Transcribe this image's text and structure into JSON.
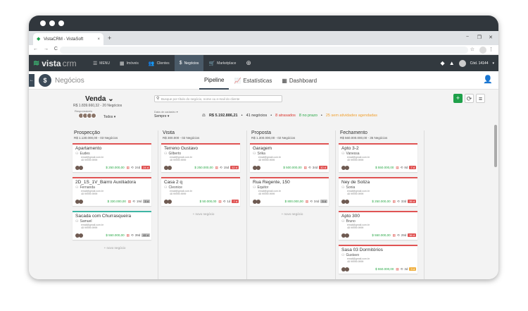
{
  "browser": {
    "tab_title": "VistaCRM - VistaSoft",
    "tab_close": "×",
    "new_tab": "+",
    "controls": [
      "−",
      "❐",
      "✕"
    ],
    "nav": "← → C",
    "star": "☆",
    "menu": "⋮"
  },
  "appnav": {
    "logo_a": "vista",
    "logo_b": "crm",
    "items": [
      {
        "icon": "menu-icon",
        "glyph": "☰",
        "label": "MENU"
      },
      {
        "icon": "building-icon",
        "glyph": "▦",
        "label": "Imóveis"
      },
      {
        "icon": "people-icon",
        "glyph": "👥",
        "label": "Clientes"
      },
      {
        "icon": "dollar-icon",
        "glyph": "$",
        "label": "Negócios"
      },
      {
        "icon": "cart-icon",
        "glyph": "🛒",
        "label": "Marketplace"
      },
      {
        "icon": "plus-circle-icon",
        "glyph": "⊕",
        "label": ""
      }
    ],
    "user_code": "Cód. 14144"
  },
  "subhead": {
    "back": "←",
    "module_icon": "$",
    "module_name": "Negócios",
    "tabs": [
      {
        "icon": "",
        "label": "Pipeline"
      },
      {
        "icon": "📈",
        "label": "Estatísticas"
      },
      {
        "icon": "▦",
        "label": "Dashboard"
      }
    ]
  },
  "filters": {
    "pipeline_title": "Venda ⌄",
    "pipeline_summary": "R$ 1.839.660,32 - 20 Negócios",
    "responsaveis_label": "Responsáveis",
    "todos": "Todos ▾",
    "search_placeholder": "Busque por título do negócio, nome ou e-mail do cliente",
    "data_label": "Data de cadastro ▾",
    "data_value": "Sempre ▾",
    "total": "R$ 5.192.886,21",
    "negocios": "41 negócios",
    "atrasados": "8 atrasados",
    "no_prazo": "8 no prazo",
    "sem_atividades": "25 sem atividades agendadas"
  },
  "columns": [
    {
      "name": "Prospecção",
      "summary": "R$ 1.130.000,00 - 03 Negócios",
      "cards": [
        {
          "title": "Apartamento",
          "person": "Eudes",
          "email": "email@gmail.com.br",
          "phone": "48 99999.9999",
          "value": "$ 250.000,00",
          "days": "24d",
          "badge": "24 d",
          "badge_type": "r",
          "color": "red"
        },
        {
          "title": "2D_1S_1V_Bairro Auxiliadora",
          "person": "Fernanda",
          "email": "email@gmail.com.br",
          "phone": "48 99999.9999",
          "value": "$ 330.000,00",
          "days": "19d",
          "badge": "5 d",
          "badge_type": "g",
          "color": "red"
        },
        {
          "title": "Sacada com Churrasqueira",
          "person": "Samuel",
          "email": "email@gmail.com.br",
          "phone": "48 99999.9999",
          "value": "$ 550.000,00",
          "days": "39d",
          "badge": "45 d",
          "badge_type": "g",
          "color": "teal"
        }
      ],
      "new_label": "+ novo negócio"
    },
    {
      "name": "Visita",
      "summary": "R$ 300.000 - 02 Negócios",
      "cards": [
        {
          "title": "Terreno Gustavo",
          "person": "Gilberto",
          "email": "email@gmail.com.br",
          "phone": "48 99999.9999",
          "value": "$ 250.000,00",
          "days": "15d",
          "badge": "12 d",
          "badge_type": "r",
          "color": "red"
        },
        {
          "title": "Casa 2 q",
          "person": "Cleonice",
          "email": "email@gmail.com.br",
          "phone": "48 99999.9999",
          "value": "$ 50.000,00",
          "days": "1d",
          "badge": "7 d",
          "badge_type": "r",
          "color": "red"
        }
      ],
      "new_label": "+ novo negócio"
    },
    {
      "name": "Proposta",
      "summary": "R$ 1.300.000,00 - 02 Negócios",
      "cards": [
        {
          "title": "Garagem",
          "person": "Srika",
          "email": "email@gmail.com.br",
          "phone": "48 99999.9999",
          "value": "$ 500.000,00",
          "days": "34d",
          "badge": "10 d",
          "badge_type": "r",
          "color": "red"
        },
        {
          "title": "Rua Regente, 150",
          "person": "Equitor",
          "email": "email@gmail.com.br",
          "phone": "48 99999.9999",
          "value": "$ 800.000,00",
          "days": "34d",
          "badge": "5 d",
          "badge_type": "g",
          "color": "red"
        }
      ],
      "new_label": "+ novo negócio"
    },
    {
      "name": "Fechamento",
      "summary": "R$ 560.000.000,00 - 35 Negócios",
      "cards": [
        {
          "title": "Apto 3-2",
          "person": "Vanessa",
          "email": "email@gmail.com.br",
          "phone": "48 99999.9999",
          "value": "$ 550.000,00",
          "days": "8d",
          "badge": "7 d",
          "badge_type": "r",
          "color": "red"
        },
        {
          "title": "Ney de Soliza",
          "person": "Sonia",
          "email": "email@gmail.com.br",
          "phone": "48 99999.9999",
          "value": "$ 250.000,00",
          "days": "33d",
          "badge": "35 d",
          "badge_type": "r",
          "color": "red"
        },
        {
          "title": "Apto 300",
          "person": "Bruno",
          "email": "email@gmail.com.br",
          "phone": "48 99999.9999",
          "value": "$ 550.000,00",
          "days": "29d",
          "badge": "36 d",
          "badge_type": "r",
          "color": "red"
        },
        {
          "title": "Sasa 03 Dormitórios",
          "person": "Gustavo",
          "email": "email@gmail.com.br",
          "phone": "48 99999.9999",
          "value": "$ 550.000,00",
          "days": "3d",
          "badge": "3 d",
          "badge_type": "o",
          "color": "red"
        }
      ]
    }
  ],
  "colors": {
    "accent": "#1fa04a",
    "nav_bg": "#32393f",
    "active_nav": "#4a5a68",
    "overdue": "#e05353"
  }
}
